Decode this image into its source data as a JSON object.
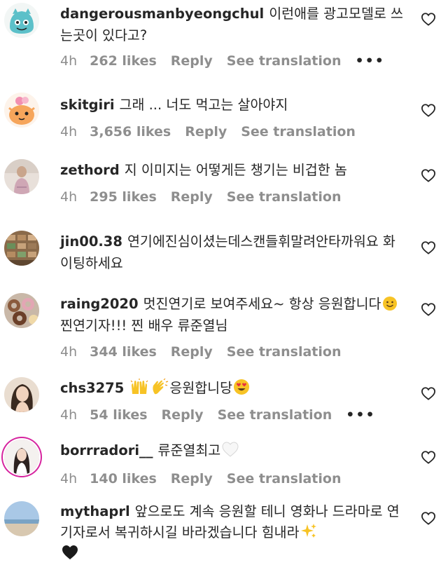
{
  "comments": [
    {
      "username": "dangerousmanbyeongchul",
      "text": "이런애를 광고모델로 쓰는곳이 있다고?",
      "time": "4h",
      "likes": "262 likes",
      "reply": "Reply",
      "translate": "See translation",
      "more": "•••"
    },
    {
      "username": "skitgiri",
      "text": "그래 ... 너도 먹고는 살아야지",
      "time": "4h",
      "likes": "3,656 likes",
      "reply": "Reply",
      "translate": "See translation"
    },
    {
      "username": "zethord",
      "text": "지 이미지는 어떻게든 챙기는 비겁한 놈",
      "time": "4h",
      "likes": "295 likes",
      "reply": "Reply",
      "translate": "See translation"
    },
    {
      "username": "jin00.38",
      "text": "연기에진심이셨는데스캔들휘말려안타까워요 화이팅하세요"
    },
    {
      "username": "raing2020",
      "text_part1": "멋진연기로 보여주세요~ 항상 응원합니다",
      "text_part2": " 찐연기자!!! 찐 배우 류준열님",
      "time": "4h",
      "likes": "344 likes",
      "reply": "Reply",
      "translate": "See translation"
    },
    {
      "username": "chs3275",
      "text": "응원합니당",
      "time": "4h",
      "likes": "54 likes",
      "reply": "Reply",
      "translate": "See translation",
      "more": "•••"
    },
    {
      "username": "borrradori__",
      "text": "류준열최고",
      "time": "4h",
      "likes": "140 likes",
      "reply": "Reply",
      "translate": "See translation"
    },
    {
      "username": "mythaprl",
      "text": "앞으로도 계속 응원할 테니 영화나 드라마로 연기자로서 복귀하시길 바라겠습니다 힘내라"
    }
  ],
  "icons": {
    "heart": "heart-outline-icon",
    "more": "more-horizontal-icon"
  },
  "colors": {
    "text": "#262626",
    "secondary": "#8e8e8e",
    "story_ring": "#d6249f"
  }
}
